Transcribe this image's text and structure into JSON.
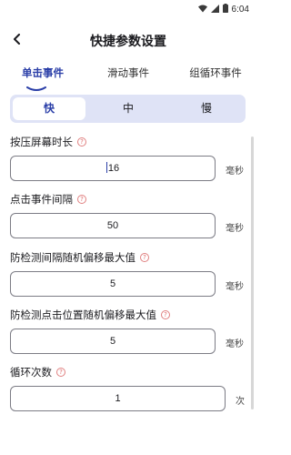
{
  "status_bar": {
    "time": "6:04"
  },
  "header": {
    "title": "快捷参数设置"
  },
  "tabs": [
    {
      "label": "单击事件",
      "active": true
    },
    {
      "label": "滑动事件",
      "active": false
    },
    {
      "label": "组循环事件",
      "active": false
    }
  ],
  "speed_options": [
    {
      "label": "快",
      "active": true
    },
    {
      "label": "中",
      "active": false
    },
    {
      "label": "慢",
      "active": false
    }
  ],
  "fields": [
    {
      "label": "按压屏幕时长",
      "value": "16",
      "unit": "毫秒"
    },
    {
      "label": "点击事件间隔",
      "value": "50",
      "unit": "毫秒"
    },
    {
      "label": "防检测间隔随机偏移最大值",
      "value": "5",
      "unit": "毫秒"
    },
    {
      "label": "防检测点击位置随机偏移最大值",
      "value": "5",
      "unit": "毫秒"
    },
    {
      "label": "循环次数",
      "value": "1",
      "unit": "次"
    }
  ],
  "help_glyph": "?",
  "colors": {
    "accent": "#2b3fa8",
    "selector_bg": "#dfe3f6",
    "help": "#e07070"
  }
}
